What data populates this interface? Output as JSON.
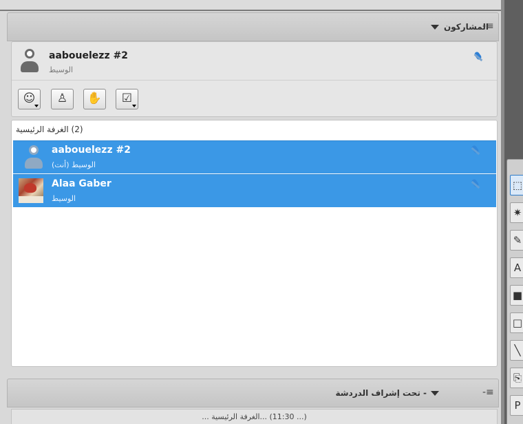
{
  "participants_panel": {
    "title": "المشاركون",
    "menu_icon": "list-menu-icon"
  },
  "self": {
    "name": "aabouelezz #2",
    "role": "الوسيط",
    "mic_icon": "microphone-icon"
  },
  "self_toolbar": [
    {
      "icon": "emoticon-icon",
      "glyph": "☺"
    },
    {
      "icon": "user-options-icon",
      "glyph": "♙"
    },
    {
      "icon": "raise-hand-icon",
      "glyph": "✋"
    },
    {
      "icon": "checkbox-poll-icon",
      "glyph": "☑"
    }
  ],
  "room": {
    "label": "(2) الغرفة الرئيسية",
    "participants": [
      {
        "name": "aabouelezz #2",
        "role": "الوسيط (أنت)"
      },
      {
        "name": "Alaa Gaber",
        "role": "الوسيط"
      }
    ]
  },
  "chat_panel": {
    "title": "- تحت إشراف الدردشة",
    "message": "(... 11:30) ...الغرفة الرئيسية ..."
  },
  "right_toolbar": [
    {
      "icon": "select-tool-icon",
      "glyph": "⬚",
      "active": true
    },
    {
      "icon": "laser-pointer-icon",
      "glyph": "✷"
    },
    {
      "icon": "pencil-icon",
      "glyph": "✎"
    },
    {
      "icon": "text-tool-icon",
      "glyph": "A"
    },
    {
      "icon": "filled-rectangle-icon",
      "glyph": "■"
    },
    {
      "icon": "rectangle-icon",
      "glyph": "□"
    },
    {
      "icon": "line-tool-icon",
      "glyph": "╲"
    },
    {
      "icon": "clipboard-icon",
      "glyph": "⎘"
    },
    {
      "icon": "page-icon",
      "glyph": "P"
    }
  ],
  "colors": {
    "selection": "#3b98e6",
    "mic": "#2d7fd6"
  }
}
